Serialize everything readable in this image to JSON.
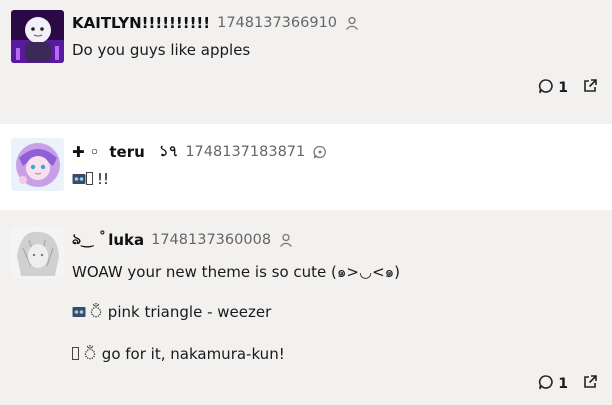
{
  "posts": [
    {
      "author": "KAITLYN!!!!!!!!!!",
      "timestamp": "1748137366910",
      "badge_icon": "user-icon",
      "lines": [
        "Do you guys like apples"
      ],
      "reply_count": "1",
      "avatar_colors": [
        "#2a0a44",
        "#7b2fd6",
        "#e8e0f0"
      ]
    },
    {
      "author_prefix": "✚ ◦",
      "author": "teru",
      "author_suffix": "১৭",
      "timestamp": "1748137183871",
      "badge_icon": "speech-bubble-icon",
      "lines": [
        "!!"
      ],
      "avatar_colors": [
        "#c7a0e8",
        "#4a9fd8",
        "#f7c9e3"
      ]
    },
    {
      "author_prefix": "ঌ‿ ˚",
      "author": "luka",
      "timestamp": "1748137360008",
      "badge_icon": "user-icon",
      "lines": [
        "WOAW your new theme is so cute (๑>◡<๑)",
        "ঁ pink triangle - weezer",
        "ঁ go for it, nakamura-kun!"
      ],
      "reply_count": "1",
      "avatar_colors": [
        "#e6e6e6",
        "#b8b8b8",
        "#ffffff"
      ]
    }
  ],
  "icons": {
    "reply": "reply-icon",
    "open": "external-link-icon",
    "cassette": "cassette-icon"
  }
}
